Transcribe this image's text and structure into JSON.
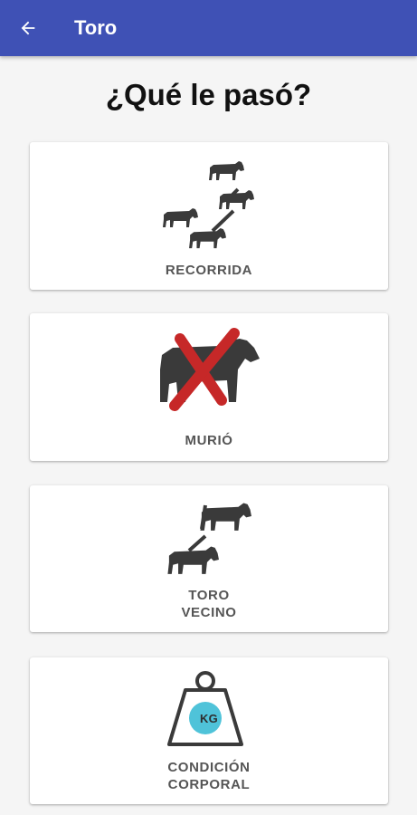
{
  "appbar": {
    "title": "Toro",
    "back_icon": "arrow-left-icon",
    "color": "#3f51b5"
  },
  "page": {
    "title": "¿Qué le pasó?"
  },
  "options": [
    {
      "label": "RECORRIDA",
      "icon": "cattle-route-icon"
    },
    {
      "label": "MURIÓ",
      "icon": "dead-cow-icon",
      "accent": "#d32f2f"
    },
    {
      "label_line1": "TORO",
      "label_line2": "VECINO",
      "icon": "neighbor-bull-icon"
    },
    {
      "label_line1": "CONDICIÓN",
      "label_line2": "CORPORAL",
      "icon": "weight-kg-icon",
      "badge": "KG",
      "badge_color": "#4fc3d9"
    }
  ]
}
